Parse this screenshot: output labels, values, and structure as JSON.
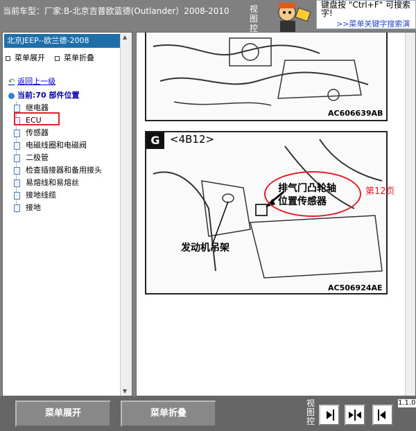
{
  "header": {
    "car_title": "当前车型：厂家:B-北京吉普欧蓝德(Outlander）2008-2010",
    "view_control": "视图控制",
    "hint_line1": "键盘按 \"Ctrl+F\" 可搜索",
    "hint_line2": "字!",
    "hint_link": ">>菜单关键字搜索演"
  },
  "sidebar": {
    "title": "北京JEEP--欧兰德-2008",
    "expand_label": "菜单展开",
    "collapse_label": "菜单折叠",
    "back_label": "返回上一级",
    "current_label": "当前:70 部件位置",
    "items": [
      {
        "label": "继电器"
      },
      {
        "label": "ECU"
      },
      {
        "label": "传感器"
      },
      {
        "label": "电磁线圈和电磁阀"
      },
      {
        "label": "二极管"
      },
      {
        "label": "检查插接器和备用接头"
      },
      {
        "label": "易熔线和易熔丝"
      },
      {
        "label": "接地线缆"
      },
      {
        "label": "接地"
      }
    ]
  },
  "main": {
    "diagram1_code": "AC606639AB",
    "diagram2_badge": "G",
    "diagram2_connector": "<4B12>",
    "callout_line1": "排气门凸轮轴",
    "callout_line2": "位置传感器",
    "bracket_label": "发动机吊架",
    "diagram2_code": "AC506924AE",
    "page_note": "第12页"
  },
  "footer": {
    "expand_button": "菜单展开",
    "collapse_button": "菜单折叠",
    "view_control": "视图控",
    "version": "1.1.0"
  },
  "colors": {
    "highlight_red": "#e0202a",
    "title_blue": "#1e6fa9"
  }
}
